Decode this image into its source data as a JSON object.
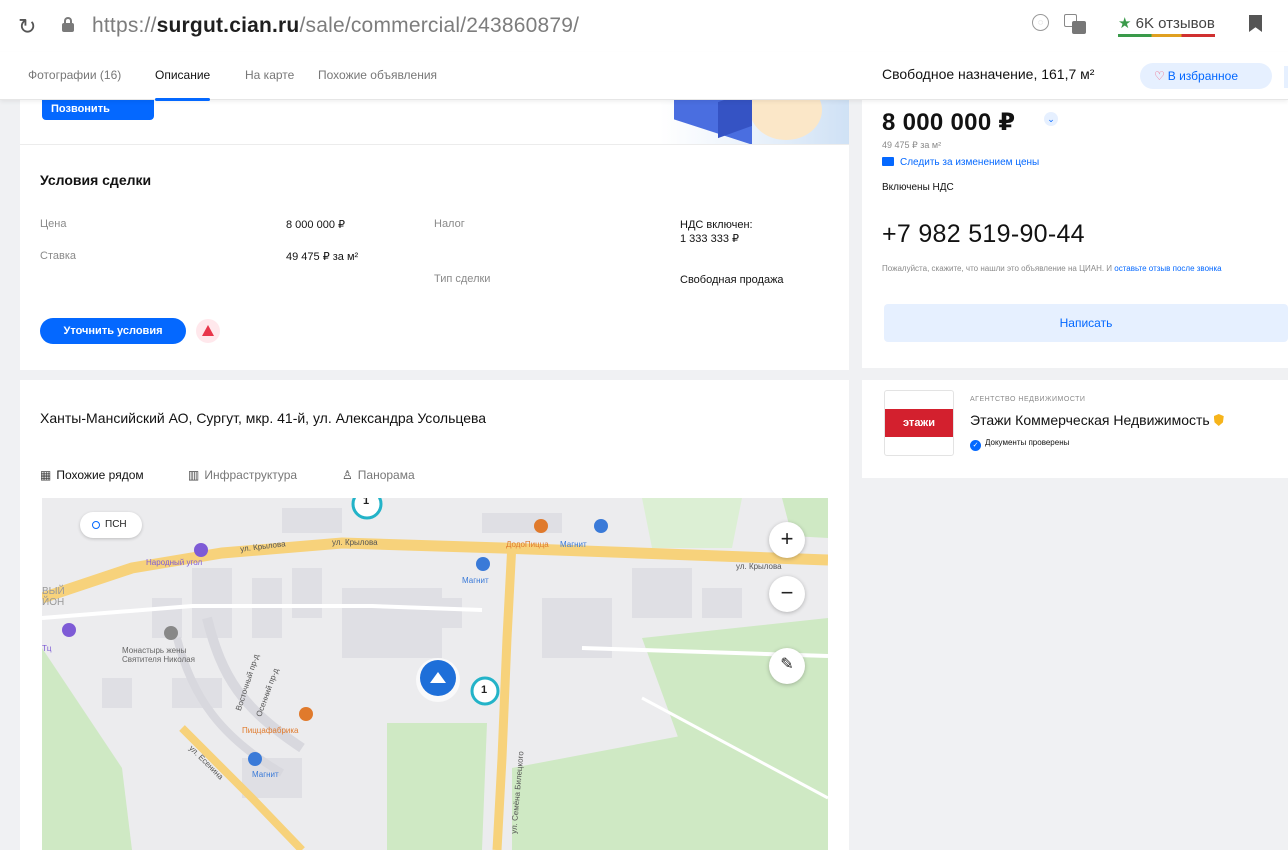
{
  "browser": {
    "url_prefix": "https://",
    "url_domain": "surgut.cian.ru",
    "url_path": "/sale/commercial/243860879/",
    "reviews_label": "6K отзывов"
  },
  "tabs": [
    {
      "label": "Фотографии (16)"
    },
    {
      "label": "Описание"
    },
    {
      "label": "На карте"
    },
    {
      "label": "Похожие объявления"
    }
  ],
  "header_summary": "Свободное назначение, 161,7 м²",
  "favorite_label": "В избранное",
  "call_button": "Позвонить",
  "conditions": {
    "title": "Условия сделки",
    "price_label": "Цена",
    "price_value": "8 000 000 ₽",
    "rate_label": "Ставка",
    "rate_value": "49 475 ₽ за м²",
    "tax_label": "Налог",
    "tax_value_1": "НДС включен:",
    "tax_value_2": "1 333 333 ₽",
    "deal_type_label": "Тип сделки",
    "deal_type_value": "Свободная продажа",
    "refine_button": "Уточнить условия"
  },
  "location": {
    "address": "Ханты-Мансийский АО, Сургут, мкр. 41-й, ул. Александра Усольцева",
    "map_tabs": [
      {
        "label": "Похожие рядом",
        "icon": "grid-icon"
      },
      {
        "label": "Инфраструктура",
        "icon": "building-icon"
      },
      {
        "label": "Панорама",
        "icon": "person-walking-icon"
      }
    ],
    "map": {
      "chip": "ПСН",
      "roads": [
        "ул. Крылова",
        "ул. Крылова",
        "ул. Крылова",
        "ул. Семёна Билецкого",
        "ул. Есенина",
        "Восточный пр-д",
        "Осенний пр-д"
      ],
      "district": "ВЫЙ\nЙОН",
      "pois": [
        "Магнит",
        "Магнит",
        "Магнит",
        "Магнит",
        "Народный угол",
        "ДодоПицца",
        "Пиццафабрика",
        "Монастырь жены Святителя Николая",
        "Тц"
      ],
      "markers": [
        "1",
        "1"
      ],
      "zoom_in": "+",
      "zoom_out": "−"
    }
  },
  "sidebar": {
    "price": "8 000 000 ₽",
    "price_per_m2": "49 475 ₽ за м²",
    "watch_price": "Следить за изменением цены",
    "vat_note": "Включены НДС",
    "phone": "+7 982 519-90-44",
    "hint": "Пожалуйста, скажите, что нашли это объявление на ЦИАН. И",
    "hint_link": "оставьте отзыв после звонка",
    "write_button": "Написать"
  },
  "agency": {
    "kind": "агентство недвижимости",
    "name": "Этажи Коммерческая Недвижимость",
    "logo_text": "этажи",
    "verified": "Документы проверены"
  },
  "colors": {
    "accent": "#0468ff",
    "page_bg": "#f0f1f3",
    "road": "#f7d27b",
    "park": "#cfe9c4",
    "agency_red": "#d3202e"
  }
}
